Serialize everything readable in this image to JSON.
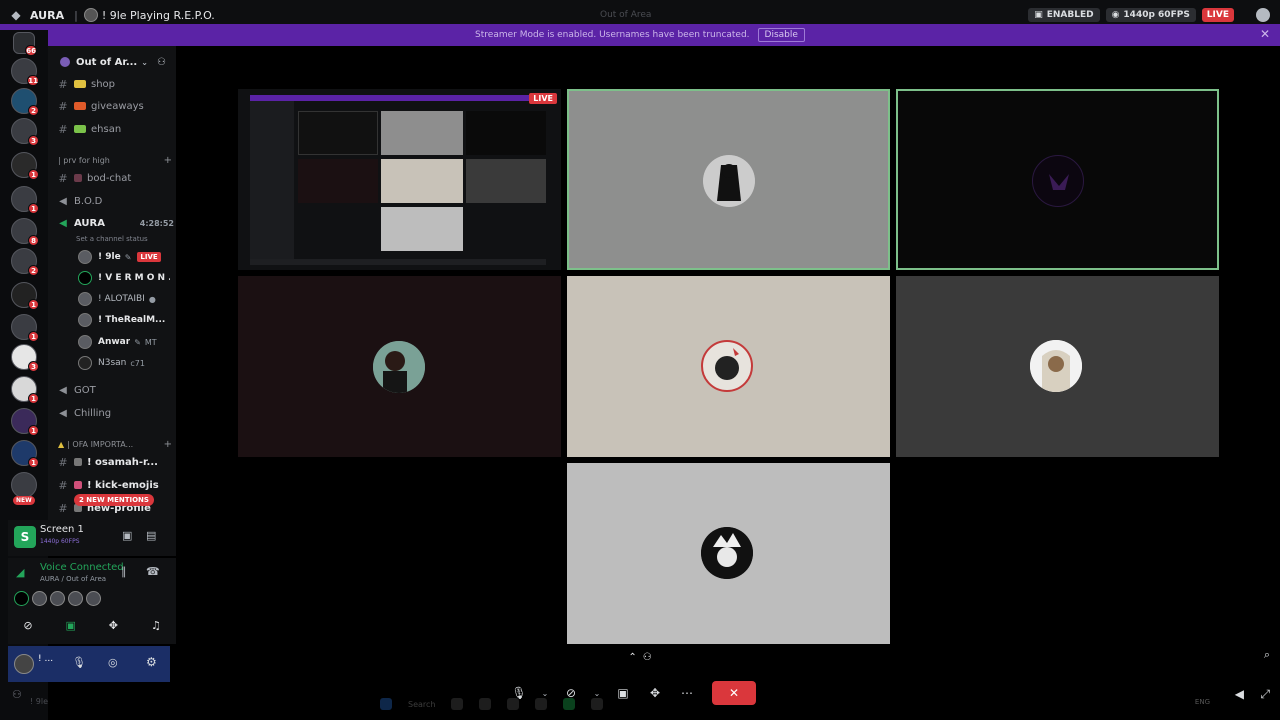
{
  "titlebar": {
    "app_name": "AURA",
    "status_text": "! 9le Playing R.E.P.O.",
    "center_title": "Out of Area",
    "enabled_badge": "ENABLED",
    "quality_badge": "1440p 60FPS",
    "live_badge": "LIVE"
  },
  "banner": {
    "text": "Streamer Mode is enabled. Usernames have been truncated.",
    "disable_label": "Disable",
    "close": "✕"
  },
  "server_rail": {
    "home_badge": "66",
    "badges": [
      "11",
      "2",
      "3",
      "1",
      "1",
      "8",
      "2",
      "1",
      "1",
      "3",
      "1",
      "1",
      "1"
    ],
    "new_label": "NEW"
  },
  "sidebar": {
    "guild_name": "Out of Ar...",
    "channels_top": [
      {
        "name": "shop",
        "color": "#e0c040"
      },
      {
        "name": "giveaways",
        "color": "#e05a2a"
      },
      {
        "name": "ehsan",
        "color": "#7bc24a"
      }
    ],
    "category_1": "| prv for high",
    "bod_chat": "bod-chat",
    "bod": "B.O.D",
    "aura": "AURA",
    "aura_timer": "4:28:52",
    "aura_status": "Set a channel status",
    "voice_users": [
      {
        "name": "! 9le",
        "live": "LIVE"
      },
      {
        "name": "! V E R M O N ..."
      },
      {
        "name": "! ALOTAIBI"
      },
      {
        "name": "! TheRealM..."
      },
      {
        "name": "Anwar",
        "tag": "MT"
      },
      {
        "name": "N3san",
        "tag": "c71"
      }
    ],
    "got": "GOT",
    "chilling": "Chilling",
    "category_2": "| OFA IMPORTA...",
    "ch_osamah": "! osamah-r...",
    "ch_kick": "! kick-emojis",
    "ch_new_profile": "new-profile",
    "mentions_pill": "2 NEW MENTIONS"
  },
  "screen_panel": {
    "title": "Screen 1",
    "subtitle": "1440p 60FPS"
  },
  "voice_panel": {
    "title": "Voice Connected",
    "subtitle": "AURA / Out of Area"
  },
  "user_panel": {
    "name": "! ..."
  },
  "footer": {
    "left_label": "! 9le"
  },
  "screen_share": {
    "live_label": "LIVE"
  },
  "taskbar": {
    "search": "Search",
    "lang": "ENG"
  }
}
